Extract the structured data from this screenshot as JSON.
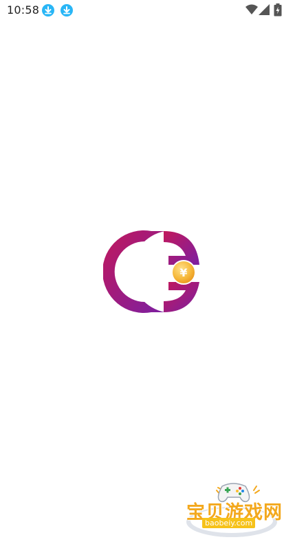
{
  "status_bar": {
    "time": "10:58",
    "notification_icons": [
      "download-icon",
      "download-icon"
    ],
    "system_icons": [
      "wifi-icon",
      "cellular-signal-icon",
      "battery-charging-icon"
    ],
    "accent": "#29b6f6"
  },
  "splash": {
    "logo_colors": [
      "#c2185b",
      "#7b1fa2",
      "#f6b93b"
    ]
  },
  "watermark": {
    "title": "宝贝游戏网",
    "url": "baobeiy.com",
    "colors": [
      "#f3a81d",
      "#f6c21a"
    ]
  }
}
